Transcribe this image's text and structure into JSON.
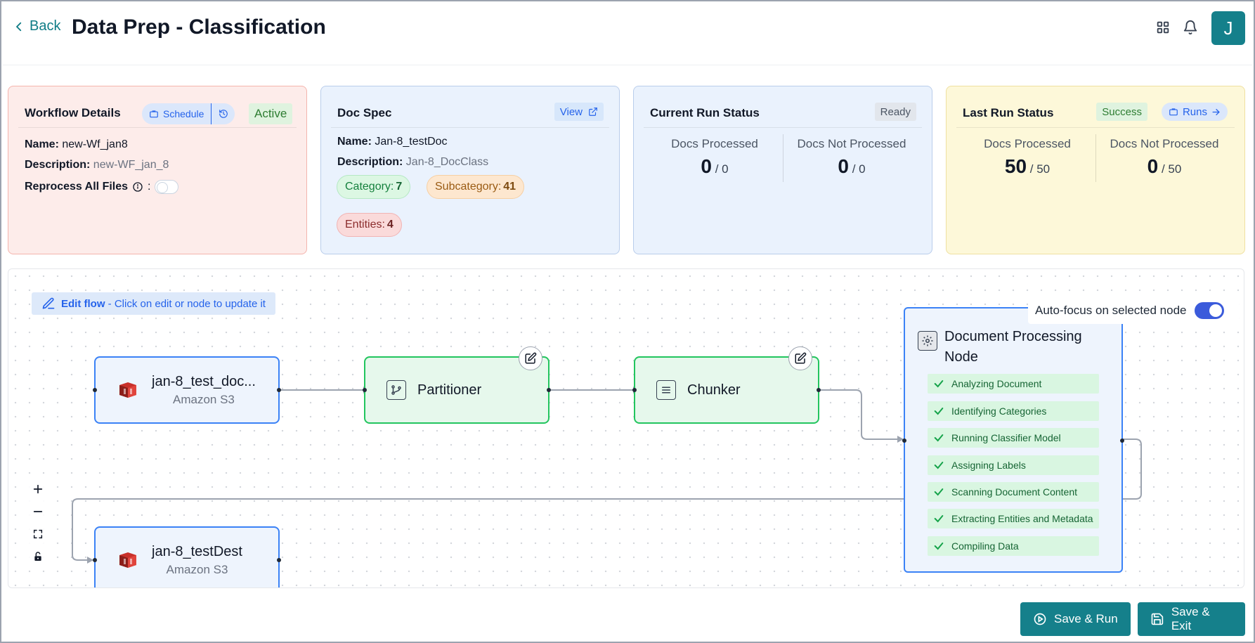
{
  "header": {
    "back_label": "Back",
    "title": "Data Prep - Classification",
    "avatar_initial": "J"
  },
  "workflow": {
    "heading": "Workflow Details",
    "schedule_label": "Schedule",
    "status": "Active",
    "name_label": "Name:",
    "name_value": "new-Wf_jan8",
    "desc_label": "Description:",
    "desc_value": "new-WF_jan_8",
    "reprocess_label": "Reprocess All Files",
    "reprocess_colon": ":"
  },
  "doc_spec": {
    "heading": "Doc Spec",
    "view_label": "View",
    "name_label": "Name:",
    "name_value": "Jan-8_testDoc",
    "desc_label": "Description:",
    "desc_value": "Jan-8_DocClass",
    "category_label": "Category:",
    "category_value": "7",
    "subcategory_label": "Subcategory:",
    "subcategory_value": "41",
    "entities_label": "Entities:",
    "entities_value": "4"
  },
  "current_run": {
    "heading": "Current Run Status",
    "status": "Ready",
    "processed_label": "Docs Processed",
    "processed_value": "0",
    "processed_total": "/ 0",
    "not_processed_label": "Docs Not Processed",
    "not_processed_value": "0",
    "not_processed_total": "/ 0"
  },
  "last_run": {
    "heading": "Last Run Status",
    "status": "Success",
    "runs_label": "Runs",
    "processed_label": "Docs Processed",
    "processed_value": "50",
    "processed_total": "/ 50",
    "not_processed_label": "Docs Not Processed",
    "not_processed_value": "0",
    "not_processed_total": "/ 50"
  },
  "flow": {
    "edit_flow_bold": "Edit flow",
    "edit_flow_text": " - Click on edit or node to update it",
    "autofocus_label": "Auto-focus on selected node",
    "source_node": {
      "title": "jan-8_test_doc...",
      "subtitle": "Amazon S3"
    },
    "partitioner_node": {
      "title": "Partitioner"
    },
    "chunker_node": {
      "title": "Chunker"
    },
    "dest_node": {
      "title": "jan-8_testDest",
      "subtitle": "Amazon S3"
    },
    "processing_node": {
      "title_line1": "Document Processing",
      "title_line2": "Node",
      "steps": [
        "Analyzing Document",
        "Identifying Categories",
        "Running Classifier Model",
        "Assigning Labels",
        "Scanning Document Content",
        "Extracting Entities and Metadata",
        "Compiling Data"
      ]
    }
  },
  "footer": {
    "save_run_label": "Save & Run",
    "save_exit_label": "Save & Exit"
  },
  "colors": {
    "accent": "#15808b",
    "link": "#2563eb",
    "success": "#22c55e"
  }
}
